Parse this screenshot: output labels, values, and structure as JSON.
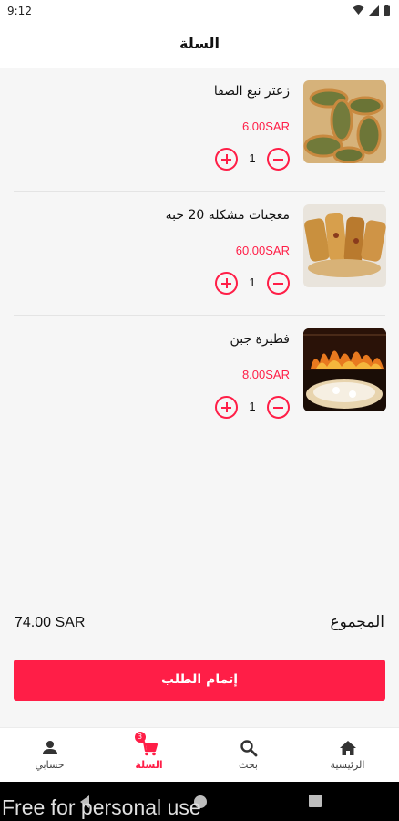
{
  "status_bar": {
    "time": "9:12"
  },
  "header": {
    "title": "السلة"
  },
  "cart": {
    "items": [
      {
        "name": "زعتر نبع الصفا",
        "price": "6.00SAR",
        "quantity": "1",
        "image": "zaatar-manakish-photo"
      },
      {
        "name": "معجنات مشكلة 20 حبة",
        "price": "60.00SAR",
        "quantity": "1",
        "image": "mixed-pastries-photo"
      },
      {
        "name": "فطيرة جبن",
        "price": "8.00SAR",
        "quantity": "1",
        "image": "cheese-pie-oven-photo"
      }
    ]
  },
  "summary": {
    "total_label": "المجموع",
    "total_value": "74.00 SAR"
  },
  "checkout": {
    "label": "إتمام الطلب"
  },
  "bottom_nav": {
    "items": [
      {
        "label": "حسابي",
        "icon": "person-icon"
      },
      {
        "label": "السلة",
        "icon": "cart-icon",
        "active": true,
        "badge": "3"
      },
      {
        "label": "بحث",
        "icon": "search-icon"
      },
      {
        "label": "الرئيسية",
        "icon": "home-icon"
      }
    ]
  },
  "watermark": "Free for personal use",
  "colors": {
    "accent": "#ff1e47",
    "background": "#f6f6f6",
    "surface": "#ffffff"
  }
}
